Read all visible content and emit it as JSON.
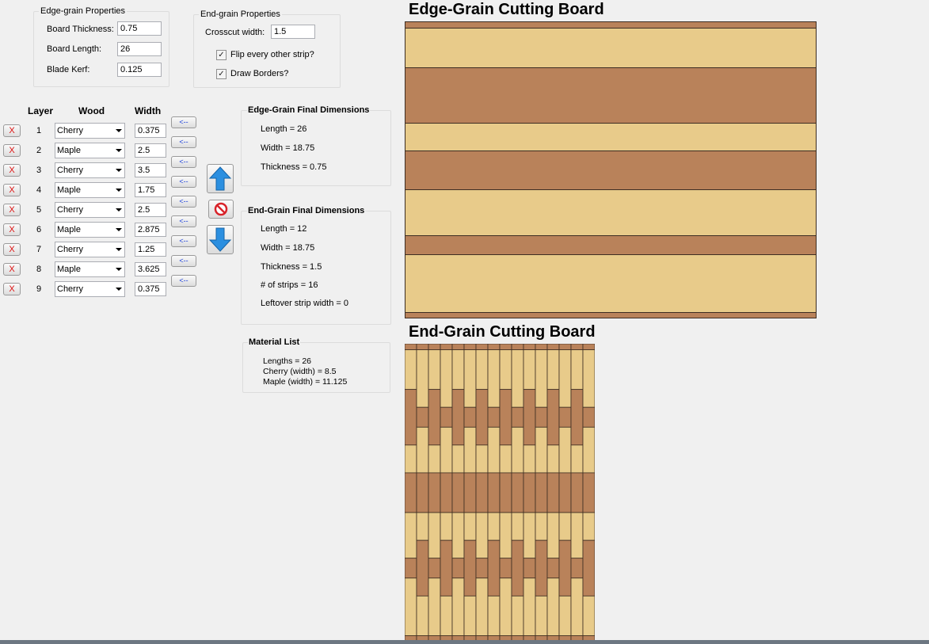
{
  "edge_props": {
    "title": "Edge-grain Properties",
    "thickness_label": "Board Thickness:",
    "thickness": "0.75",
    "length_label": "Board Length:",
    "length": "26",
    "kerf_label": "Blade Kerf:",
    "kerf": "0.125"
  },
  "end_props": {
    "title": "End-grain Properties",
    "crosscut_label": "Crosscut width:",
    "crosscut": "1.5",
    "flip_label": "Flip every other strip?",
    "flip_checked": true,
    "borders_label": "Draw Borders?",
    "borders_checked": true
  },
  "layers_table": {
    "headers": {
      "layer": "Layer",
      "wood": "Wood",
      "width": "Width"
    },
    "delete_label": "X",
    "move_label": "<--",
    "rows": [
      {
        "num": "1",
        "wood": "Cherry",
        "width": "0.375"
      },
      {
        "num": "2",
        "wood": "Maple",
        "width": "2.5"
      },
      {
        "num": "3",
        "wood": "Cherry",
        "width": "3.5"
      },
      {
        "num": "4",
        "wood": "Maple",
        "width": "1.75"
      },
      {
        "num": "5",
        "wood": "Cherry",
        "width": "2.5"
      },
      {
        "num": "6",
        "wood": "Maple",
        "width": "2.875"
      },
      {
        "num": "7",
        "wood": "Cherry",
        "width": "1.25"
      },
      {
        "num": "8",
        "wood": "Maple",
        "width": "3.625"
      },
      {
        "num": "9",
        "wood": "Cherry",
        "width": "0.375"
      }
    ]
  },
  "edge_final": {
    "title": "Edge-Grain Final Dimensions",
    "length": "Length = 26",
    "width": "Width = 18.75",
    "thickness": "Thickness = 0.75"
  },
  "end_final": {
    "title": "End-Grain Final Dimensions",
    "length": "Length = 12",
    "width": "Width = 18.75",
    "thickness": "Thickness = 1.5",
    "strips": "# of strips = 16",
    "leftover": "Leftover strip width = 0"
  },
  "material": {
    "title": "Material List",
    "lengths": "Lengths = 26",
    "cherry": "Cherry (width) = 8.5",
    "maple": "Maple (width) = 11.125"
  },
  "edge_board": {
    "title": "Edge-Grain Cutting Board"
  },
  "end_board": {
    "title": "End-Grain Cutting Board"
  },
  "colors": {
    "cherry": "#b9825a",
    "maple": "#e8cb8a",
    "border": "#3d2d22"
  }
}
